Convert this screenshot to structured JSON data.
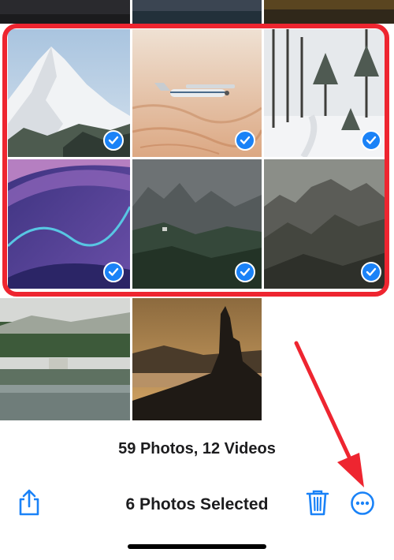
{
  "library": {
    "counts_label": "59 Photos, 12 Videos"
  },
  "toolbar": {
    "selected_label": "6 Photos Selected",
    "share_icon": "share-icon",
    "trash_icon": "trash-icon",
    "more_icon": "ellipsis-circle-icon"
  },
  "selection": {
    "selected_count": 6,
    "check_icon": "checkmark-circle-icon"
  },
  "colors": {
    "accent": "#1a82f7",
    "highlight": "#ee2530",
    "annotation_arrow": "#ee2530"
  }
}
